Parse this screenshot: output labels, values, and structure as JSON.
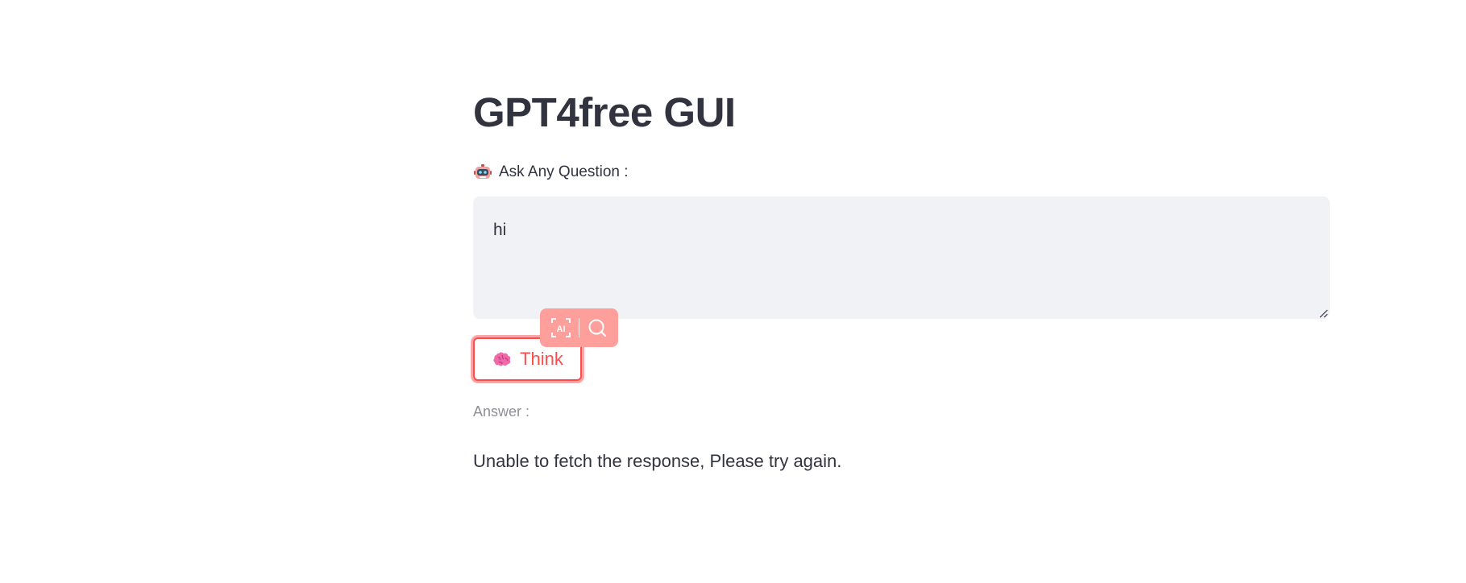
{
  "app": {
    "title": "GPT4free GUI"
  },
  "question": {
    "icon": "robot-icon",
    "label": "Ask Any Question :",
    "value": "hi"
  },
  "toolbar": {
    "items": [
      {
        "icon": "ai-scan-icon"
      },
      {
        "icon": "search-icon"
      }
    ],
    "bg_color": "#ff9f9c"
  },
  "think_button": {
    "icon": "brain-icon",
    "label": "Think",
    "accent_color": "#ff4b4b"
  },
  "answer": {
    "label": "Answer :",
    "text": "Unable to fetch the response, Please try again."
  }
}
